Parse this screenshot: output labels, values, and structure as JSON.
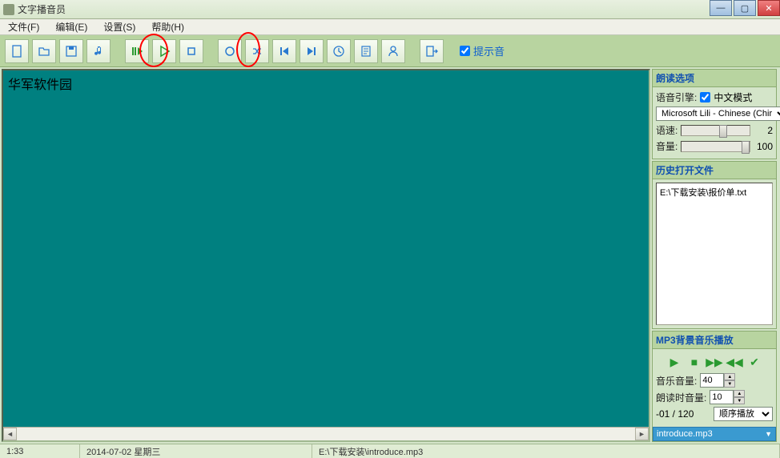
{
  "window": {
    "title": "文字播音员"
  },
  "menu": {
    "file": "文件(F)",
    "edit": "编辑(E)",
    "settings": "设置(S)",
    "help": "帮助(H)"
  },
  "toolbar": {
    "hint_sound_label": "提示音",
    "hint_sound_checked": true
  },
  "editor": {
    "text": "华军软件园"
  },
  "read_options": {
    "title": "朗读选项",
    "engine_label": "语音引擎:",
    "chinese_mode_label": "中文模式",
    "chinese_mode_checked": true,
    "engine_value": "Microsoft Lili - Chinese (Chir",
    "speed_label": "语速:",
    "speed_value": "2",
    "volume_label": "音量:",
    "volume_value": "100"
  },
  "history": {
    "title": "历史打开文件",
    "items": [
      "E:\\下载安装\\报价单.txt"
    ]
  },
  "mp3": {
    "title": "MP3背景音乐播放",
    "music_vol_label": "音乐音量:",
    "music_vol_value": "40",
    "read_vol_label": "朗读时音量:",
    "read_vol_value": "10",
    "position": "-01 / 120",
    "mode_label": "顺序播放",
    "file": "introduce.mp3"
  },
  "status": {
    "time": "1:33",
    "date": "2014-07-02 星期三",
    "path": "E:\\下载安装\\introduce.mp3"
  }
}
